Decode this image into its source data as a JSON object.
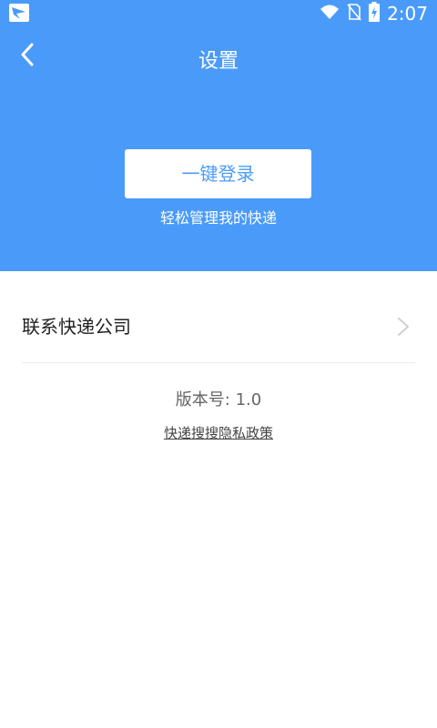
{
  "status_bar": {
    "time": "2:07",
    "icons": [
      "app-notification-icon",
      "wifi-icon",
      "no-sim-icon",
      "battery-charging-icon"
    ]
  },
  "header": {
    "title": "设置",
    "back_icon": "chevron-left-icon",
    "login_button_label": "一键登录",
    "login_subtitle": "轻松管理我的快递"
  },
  "settings": {
    "contact_label": "联系快递公司",
    "contact_icon": "chevron-right-icon"
  },
  "footer": {
    "version": "版本号: 1.0",
    "privacy_link": "快递搜搜隐私政策"
  },
  "colors": {
    "primary": "#4a9bf9",
    "background": "#ffffff",
    "divider": "#ececec"
  }
}
